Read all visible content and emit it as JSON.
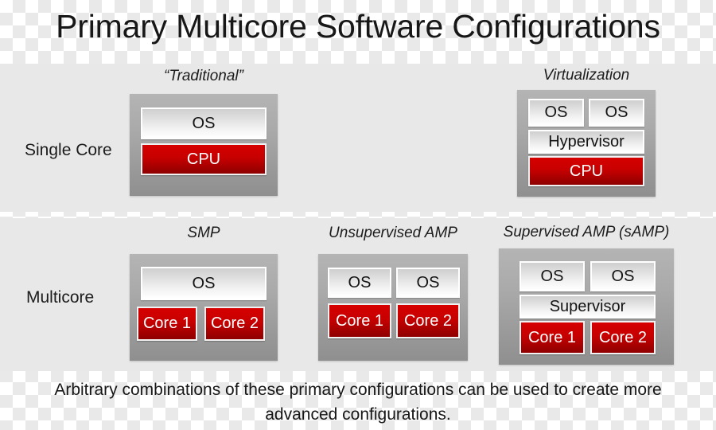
{
  "title": "Primary Multicore Software Configurations",
  "colors": {
    "panel_background": "#e8e8e8",
    "chassis_gray": "#aaaaaa",
    "cpu_red": "#c70000",
    "os_white": "#ffffff",
    "text": "#1c1c1c"
  },
  "rows": [
    {
      "label": "Single Core",
      "configs": [
        {
          "title": "“Traditional”",
          "blocks": [
            {
              "text": "OS",
              "kind": "os"
            },
            {
              "text": "CPU",
              "kind": "cpu"
            }
          ]
        },
        {
          "title": "Virtualization",
          "blocks": [
            {
              "text": "OS",
              "kind": "os"
            },
            {
              "text": "OS",
              "kind": "os"
            },
            {
              "text": "Hypervisor",
              "kind": "os"
            },
            {
              "text": "CPU",
              "kind": "cpu"
            }
          ]
        }
      ]
    },
    {
      "label": "Multicore",
      "configs": [
        {
          "title": "SMP",
          "blocks": [
            {
              "text": "OS",
              "kind": "os"
            },
            {
              "text": "Core 1",
              "kind": "cpu"
            },
            {
              "text": "Core 2",
              "kind": "cpu"
            }
          ]
        },
        {
          "title": "Unsupervised AMP",
          "blocks": [
            {
              "text": "OS",
              "kind": "os"
            },
            {
              "text": "OS",
              "kind": "os"
            },
            {
              "text": "Core 1",
              "kind": "cpu"
            },
            {
              "text": "Core 2",
              "kind": "cpu"
            }
          ]
        },
        {
          "title": "Supervised AMP (sAMP)",
          "blocks": [
            {
              "text": "OS",
              "kind": "os"
            },
            {
              "text": "OS",
              "kind": "os"
            },
            {
              "text": "Supervisor",
              "kind": "os"
            },
            {
              "text": "Core 1",
              "kind": "cpu"
            },
            {
              "text": "Core 2",
              "kind": "cpu"
            }
          ]
        }
      ]
    }
  ],
  "footer": {
    "line1": "Arbitrary combinations of these primary configurations can be used to create more",
    "line2": "advanced configurations."
  }
}
